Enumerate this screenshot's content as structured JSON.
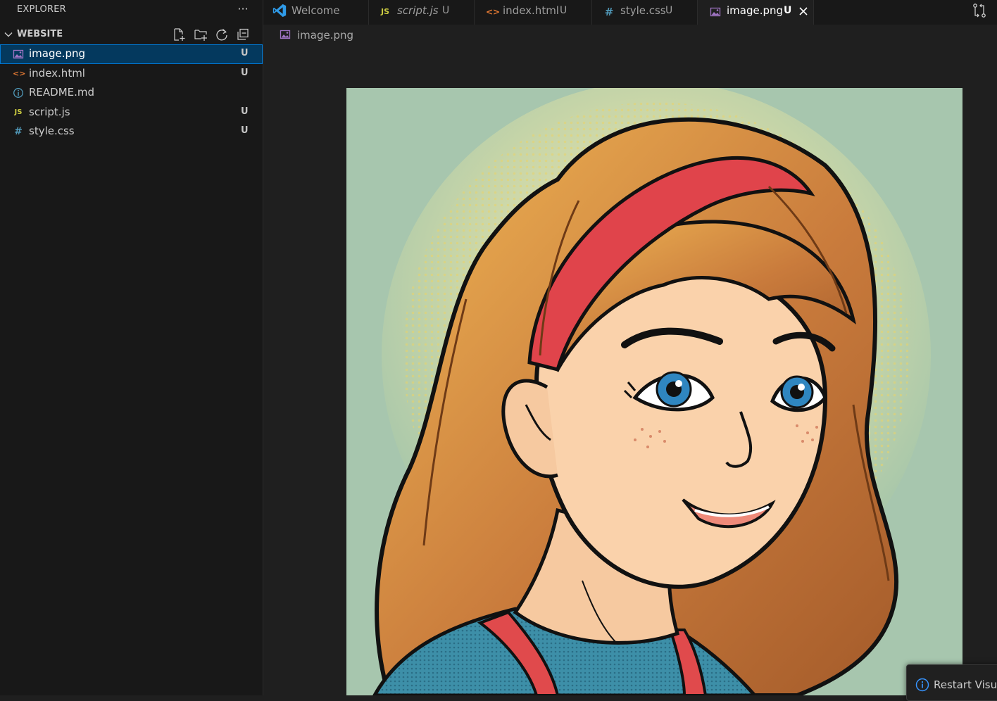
{
  "sidebar": {
    "title": "EXPLORER",
    "more_label": "···",
    "folder": "WEBSITE",
    "files": [
      {
        "name": "image.png",
        "status": "U",
        "icon": "image-file-icon",
        "selected": true
      },
      {
        "name": "index.html",
        "status": "U",
        "icon": "html-file-icon"
      },
      {
        "name": "README.md",
        "status": "",
        "icon": "info-file-icon"
      },
      {
        "name": "script.js",
        "status": "U",
        "icon": "js-file-icon"
      },
      {
        "name": "style.css",
        "status": "U",
        "icon": "css-file-icon"
      }
    ],
    "js_glyph": "JS",
    "css_glyph": "#",
    "html_glyph": "<>"
  },
  "tabs": [
    {
      "label": "Welcome",
      "status": "",
      "icon": "vscode-icon"
    },
    {
      "label": "script.js",
      "status": "U",
      "icon": "js-file-icon"
    },
    {
      "label": "index.html",
      "status": "U",
      "icon": "html-file-icon"
    },
    {
      "label": "style.css",
      "status": "U",
      "icon": "css-file-icon"
    },
    {
      "label": "image.png",
      "status": "U",
      "icon": "image-file-icon",
      "active": true
    }
  ],
  "breadcrumb": {
    "file": "image.png"
  },
  "notification": {
    "text": "Restart Visua"
  },
  "colors": {
    "accent": "#0078d4",
    "selected_bg": "#04395e",
    "js": "#cbcb41",
    "css": "#519aba",
    "html": "#e37933",
    "image": "#a074c4"
  }
}
